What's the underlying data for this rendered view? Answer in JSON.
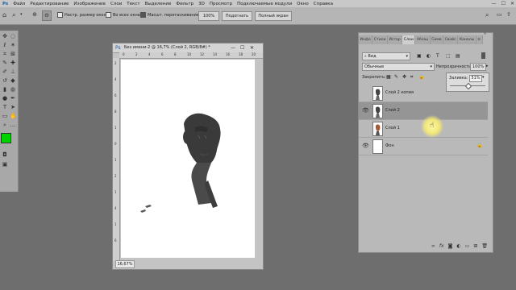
{
  "menubar": {
    "app_icon": "photoshop-icon",
    "items": [
      "Файл",
      "Редактирование",
      "Изображение",
      "Слои",
      "Текст",
      "Выделение",
      "Фильтр",
      "3D",
      "Просмотр",
      "Подключаемые модули",
      "Окно",
      "Справка"
    ]
  },
  "optionsbar": {
    "resize_windows_label": "Настр. размер окон",
    "all_windows_label": "Во всех окнах",
    "scrubby_zoom_label": "Масшт. перетаскиванием",
    "zoom_value": "100%",
    "fit_screen_label": "Подогнать",
    "fill_screen_label": "Полный экран"
  },
  "toolbar": {
    "foreground_color": "#00d200",
    "background_color": "#000000"
  },
  "document": {
    "title": "Без имени-2 @ 16,7% (Слой 2, RGB/8#) *",
    "zoom_status": "16,67%",
    "ruler_h": [
      "0",
      "2",
      "4",
      "6",
      "8",
      "10",
      "12",
      "14",
      "16",
      "18",
      "20"
    ],
    "ruler_v": [
      "2",
      "4",
      "6",
      "8",
      "1",
      "0",
      "1",
      "2",
      "1",
      "4",
      "1",
      "6"
    ]
  },
  "layers_panel": {
    "tabs": [
      "Инфо",
      "Стили",
      "Истор",
      "Слои",
      "Абзац",
      "Симв",
      "Свойс",
      "Каналы"
    ],
    "active_tab": "Слои",
    "search_kind": "Вид",
    "blend_mode": "Обычные",
    "opacity_label": "Непрозрачность:",
    "opacity_value": "100%",
    "lock_label": "Закрепить:",
    "fill_label": "Заливка:",
    "fill_value": "51%",
    "layers": [
      {
        "name": "Слой 2 копия",
        "visible": false,
        "selected": false
      },
      {
        "name": "Слой 2",
        "visible": true,
        "selected": true
      },
      {
        "name": "Слой 1",
        "visible": false,
        "selected": false
      },
      {
        "name": "Фон",
        "visible": true,
        "selected": false,
        "locked": true
      }
    ],
    "footer_fx": "fx"
  }
}
